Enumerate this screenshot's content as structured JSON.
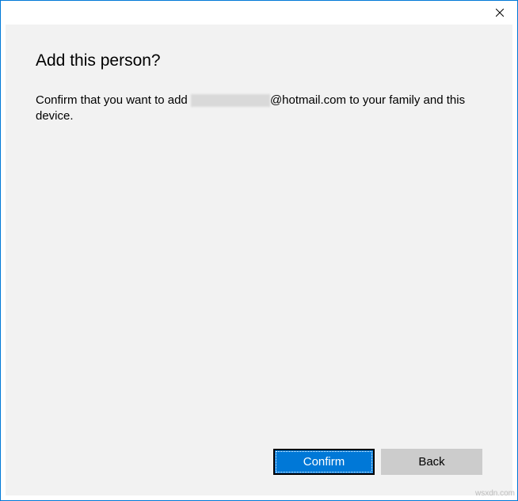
{
  "dialog": {
    "heading": "Add this person?",
    "body_prefix": "Confirm that you want to add ",
    "email_domain": "@hotmail.com",
    "body_suffix": " to your family and this device.",
    "confirm_label": "Confirm",
    "back_label": "Back"
  },
  "watermark": "wsxdn.com"
}
